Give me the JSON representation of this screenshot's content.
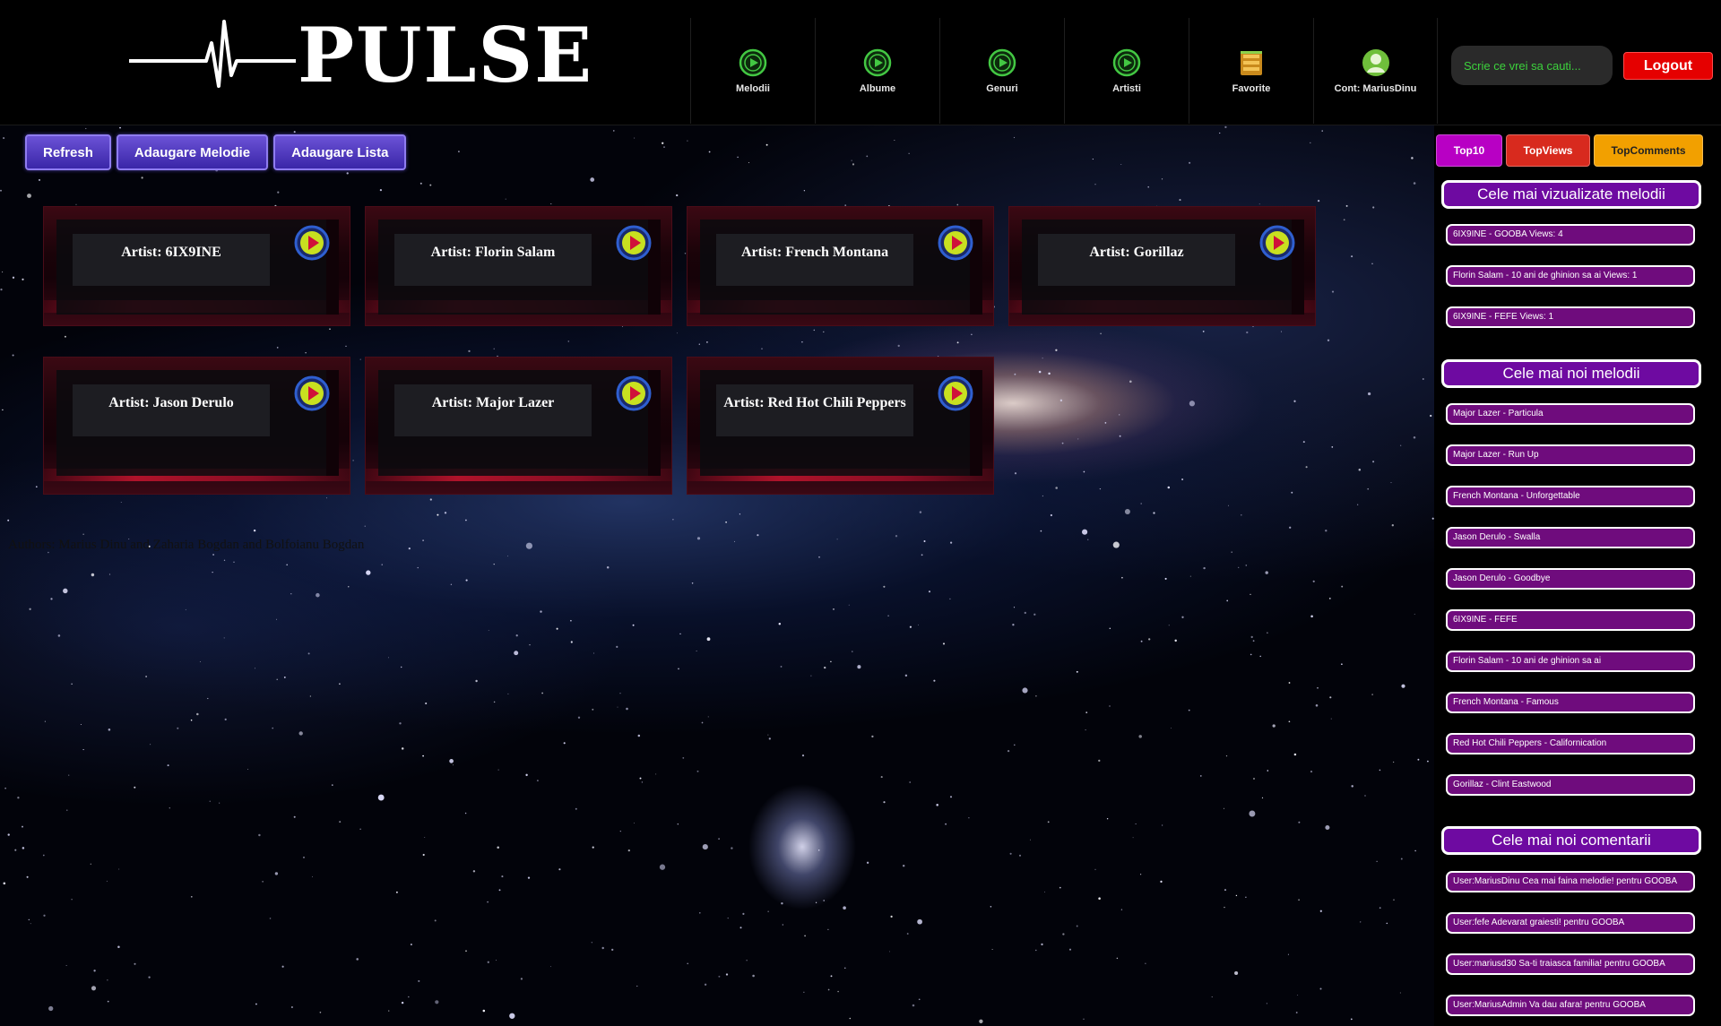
{
  "app": {
    "logo_text": "PULSE"
  },
  "nav": [
    {
      "label": "Melodii",
      "icon": "play-circle-icon"
    },
    {
      "label": "Albume",
      "icon": "play-circle-icon"
    },
    {
      "label": "Genuri",
      "icon": "play-circle-icon"
    },
    {
      "label": "Artisti",
      "icon": "play-circle-icon"
    },
    {
      "label": "Favorite",
      "icon": "favorites-box-icon"
    },
    {
      "label": "Cont: MariusDinu",
      "icon": "user-avatar-icon"
    }
  ],
  "search": {
    "placeholder": "Scrie ce vrei sa cauti..."
  },
  "logout_label": "Logout",
  "actions": {
    "refresh": "Refresh",
    "add_song": "Adaugare Melodie",
    "add_list": "Adaugare Lista"
  },
  "artists": [
    {
      "label": "Artist: 6IX9INE"
    },
    {
      "label": "Artist: Florin Salam"
    },
    {
      "label": "Artist: French Montana"
    },
    {
      "label": "Artist: Gorillaz"
    },
    {
      "label": "Artist: Jason Derulo"
    },
    {
      "label": "Artist: Major Lazer"
    },
    {
      "label": "Artist: Red Hot Chili Peppers"
    }
  ],
  "authors_text": "Authors: Marius Dinu and Zaharia Bogdan and Bolfoianu Bogdan",
  "tabs": {
    "top10": "Top10",
    "top_views": "TopViews",
    "top_comments": "TopComments"
  },
  "most_viewed": {
    "title": "Cele mai vizualizate melodii",
    "items": [
      "6IX9INE - GOOBA Views: 4",
      "Florin Salam - 10 ani de ghinion sa ai Views: 1",
      "6IX9INE - FEFE Views: 1"
    ]
  },
  "newest_songs": {
    "title": "Cele mai noi melodii",
    "items": [
      "Major Lazer - Particula",
      "Major Lazer - Run Up",
      "French Montana - Unforgettable",
      "Jason Derulo - Swalla",
      "Jason Derulo - Goodbye",
      "6IX9INE - FEFE",
      "Florin Salam - 10 ani de ghinion sa ai",
      "French Montana - Famous",
      "Red Hot Chili Peppers - Californication",
      "Gorillaz - Clint Eastwood"
    ]
  },
  "newest_comments": {
    "title": "Cele mai noi comentarii",
    "items": [
      "User:MariusDinu Cea mai faina melodie! pentru GOOBA",
      "User:fefe Adevarat graiesti! pentru GOOBA",
      "User:mariusd30 Sa-ti traiasca familia! pentru GOOBA",
      "User:MariusAdmin Va dau afara! pentru GOOBA"
    ]
  },
  "colors": {
    "header_bg": "#000000",
    "action_button": "#5a3fd0",
    "card_bg": "#2a0610",
    "play_icon": "#c8e020",
    "pill_bg": "#6f0c7d",
    "section_title_bg": "#6e0aa1",
    "logout_bg": "#e50000",
    "search_text": "#3cd23c"
  }
}
